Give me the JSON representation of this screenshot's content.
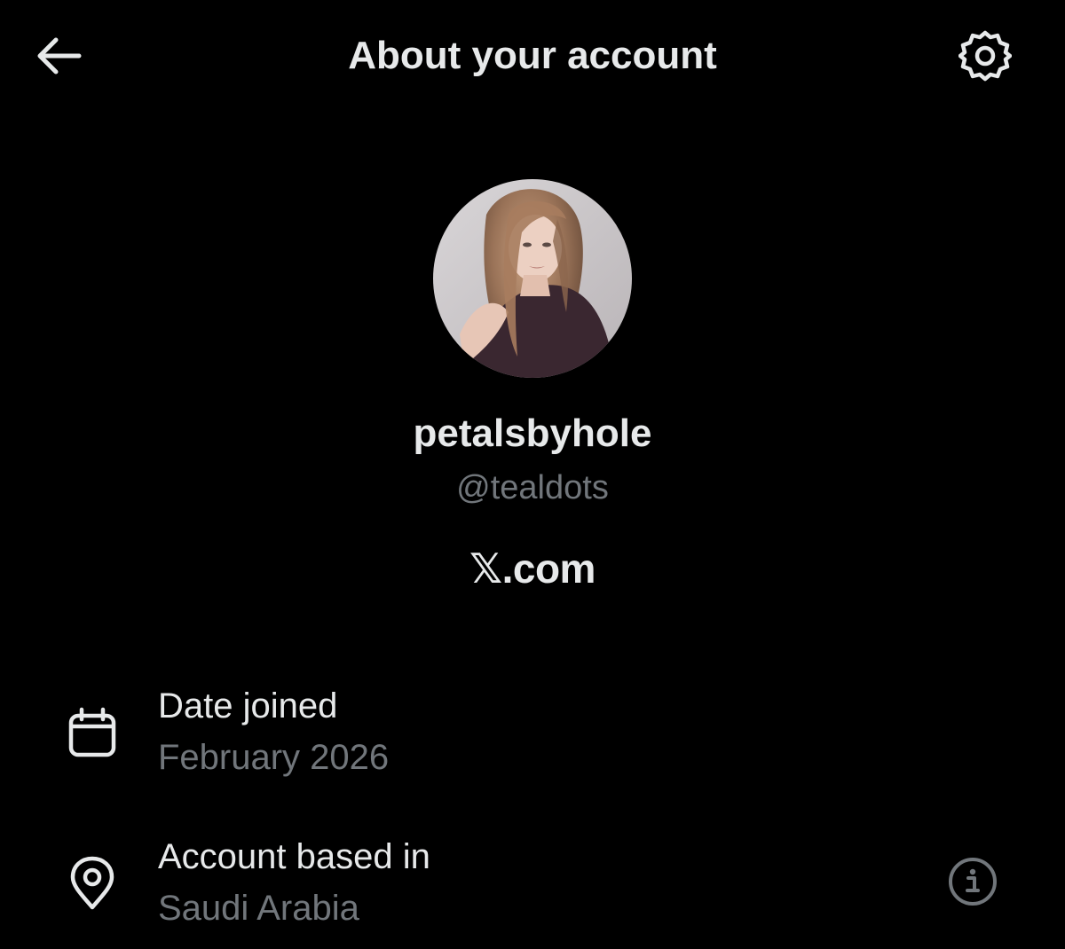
{
  "header": {
    "title": "About your account",
    "back_icon": "arrow-left-icon",
    "settings_icon": "gear-icon"
  },
  "profile": {
    "avatar_description_icon": "avatar-photo",
    "display_name": "petalsbyhole",
    "handle": "@tealdots",
    "brand_text": "𝕏.com"
  },
  "details": {
    "date_joined": {
      "icon": "calendar-icon",
      "label": "Date joined",
      "value": "February 2026"
    },
    "account_based_in": {
      "icon": "location-pin-icon",
      "label": "Account based in",
      "value": "Saudi Arabia",
      "info_icon": "info-icon"
    }
  },
  "colors": {
    "background": "#000000",
    "primary_text": "#e7e9ea",
    "secondary_text": "#71767b"
  }
}
